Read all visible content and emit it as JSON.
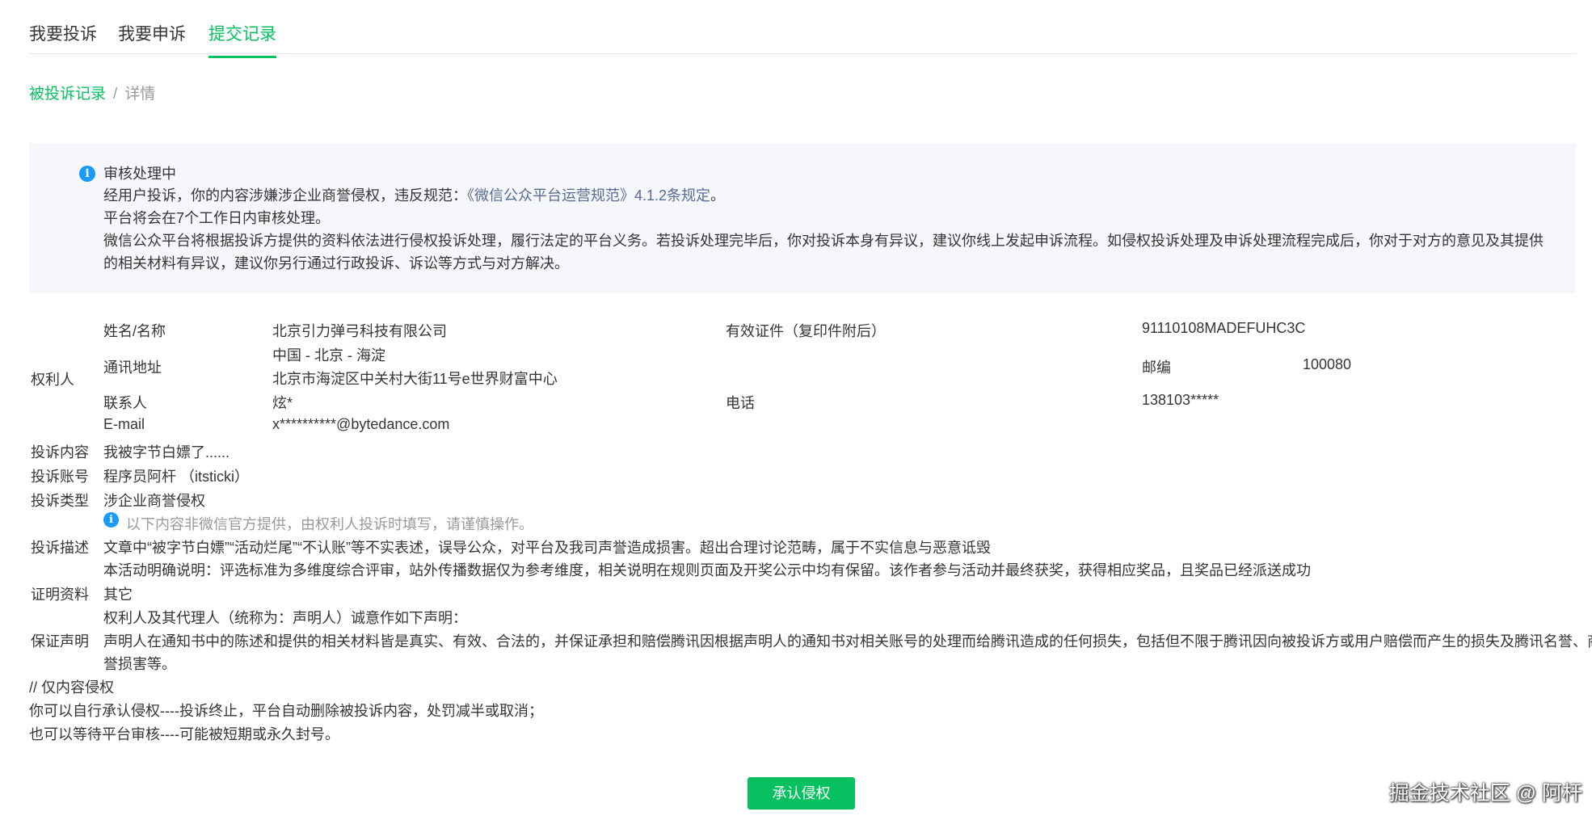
{
  "tabs": [
    "我要投诉",
    "我要申诉",
    "提交记录"
  ],
  "breadcrumb": {
    "parent": "被投诉记录",
    "separator": "/",
    "current": "详情"
  },
  "notice": {
    "status": "审核处理中",
    "line1_prefix": "经用户投诉，你的内容涉嫌涉企业商誉侵权，违反规范：",
    "line1_link": "《微信公众平台运营规范》4.1.2条规定",
    "line1_suffix": "。",
    "line2": "平台将会在7个工作日内审核处理。",
    "line3": "微信公众平台将根据投诉方提供的资料依法进行侵权投诉处理，履行法定的平台义务。若投诉处理完毕后，你对投诉本身有异议，建议你线上发起申诉流程。如侵权投诉处理及申诉处理流程完成后，你对于对方的意见及其提供",
    "line4": "的相关材料有异议，建议你另行通过行政投诉、诉讼等方式与对方解决。"
  },
  "rights_holder": {
    "section_label": "权利人",
    "name_label": "姓名/名称",
    "name": "北京引力弹弓科技有限公司",
    "cert_label": "有效证件（复印件附后）",
    "cert": "91110108MADEFUHC3C",
    "address_label": "通讯地址",
    "address_line1": "中国 - 北京 - 海淀",
    "address_line2": "北京市海淀区中关村大街11号e世界财富中心",
    "zip_label": "邮编",
    "zip": "100080",
    "contact_label": "联系人",
    "contact": "炫*",
    "phone_label": "电话",
    "phone": "138103*****",
    "email_label": "E-mail",
    "email": "x**********@bytedance.com"
  },
  "complaint": {
    "content_label": "投诉内容",
    "content": "我被字节白嫖了......",
    "account_label": "投诉账号",
    "account": "程序员阿杆 （itsticki）",
    "type_label": "投诉类型",
    "type": "涉企业商誉侵权",
    "hint": "以下内容非微信官方提供，由权利人投诉时填写，请谨慎操作。",
    "desc_label": "投诉描述",
    "desc1": "文章中“被字节白嫖”“活动烂尾”“不认账”等不实表述，误导公众，对平台及我司声誉造成损害。超出合理讨论范畴，属于不实信息与恶意诋毁",
    "desc2": "本活动明确说明：评选标准为多维度综合评审，站外传播数据仅为参考维度，相关说明在规则页面及开奖公示中均有保留。该作者参与活动并最终获奖，获得相应奖品，且奖品已经派送成功",
    "proof_label": "证明资料",
    "proof": "其它",
    "statement_label": "保证声明",
    "statement1": "权利人及其代理人（统称为：声明人）诚意作如下声明：",
    "statement2": "声明人在通知书中的陈述和提供的相关材料皆是真实、有效、合法的，并保证承担和赔偿腾讯因根据声明人的通知书对相关账号的处理而给腾讯造成的任何损失，包括但不限于腾讯因向被投诉方或用户赔偿而产生的损失及腾讯名誉、商",
    "statement3": "誉损害等。"
  },
  "notes": {
    "note1": "// 仅内容侵权",
    "note2": "你可以自行承认侵权----投诉终止，平台自动删除被投诉内容，处罚减半或取消；",
    "note3": "也可以等待平台审核----可能被短期或永久封号。"
  },
  "button": {
    "label": "承认侵权"
  },
  "watermark": "掘金技术社区 @ 阿杆",
  "colors": {
    "accent": "#07c160",
    "link": "#576b95",
    "info": "#1a9bfc",
    "muted": "#9a9a9a"
  }
}
